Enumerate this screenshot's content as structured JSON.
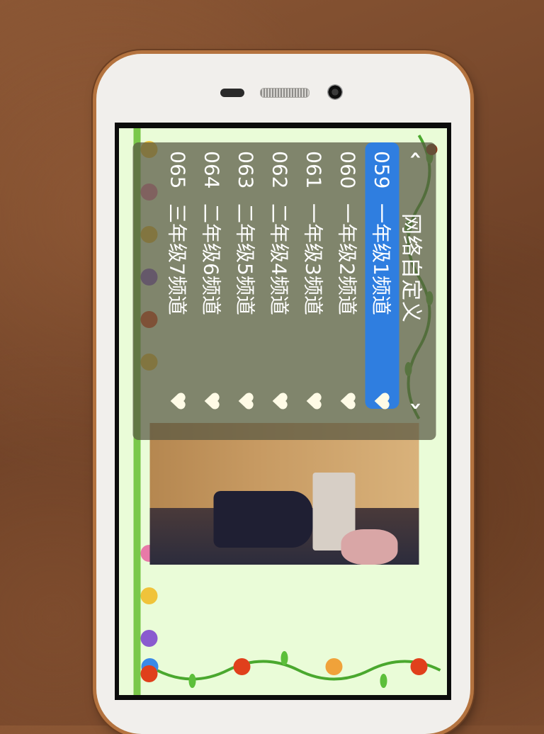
{
  "panel": {
    "title": "网络自定义",
    "nav": {
      "prev_icon": "chevron-left",
      "next_icon": "chevron-right"
    }
  },
  "channels": [
    {
      "number": "059",
      "name": "一年级1频道",
      "selected": true
    },
    {
      "number": "060",
      "name": "一年级2频道",
      "selected": false
    },
    {
      "number": "061",
      "name": "一年级3频道",
      "selected": false
    },
    {
      "number": "062",
      "name": "二年级4频道",
      "selected": false
    },
    {
      "number": "063",
      "name": "二年级5频道",
      "selected": false
    },
    {
      "number": "064",
      "name": "二年级6频道",
      "selected": false
    },
    {
      "number": "065",
      "name": "三年级7频道",
      "selected": false
    }
  ],
  "colors": {
    "selected": "#2f7ee0",
    "panel": "#58584280"
  }
}
